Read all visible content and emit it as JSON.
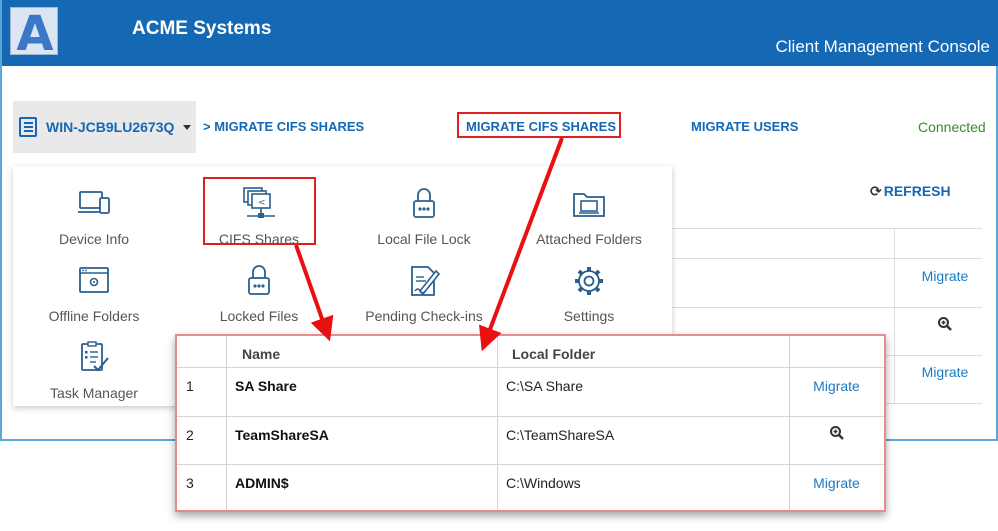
{
  "app": {
    "logo_letter": "A",
    "title": "ACME Systems",
    "console_title": "Client Management Console"
  },
  "device": {
    "name": "WIN-JCB9LU2673Q"
  },
  "nav": {
    "breadcrumb": "> MIGRATE CIFS SHARES",
    "migrate_cifs": "MIGRATE CIFS SHARES",
    "migrate_users": "MIGRATE USERS",
    "status": "Connected"
  },
  "toolbar": {
    "refresh": "REFRESH",
    "refresh_icon": "refresh-icon"
  },
  "menu": {
    "tiles": [
      {
        "label": "Device Info",
        "icon": "devices-icon"
      },
      {
        "label": "CIFS Shares",
        "icon": "network-share-icon"
      },
      {
        "label": "Local File Lock",
        "icon": "lock-icon"
      },
      {
        "label": "Attached Folders",
        "icon": "attached-folder-icon"
      },
      {
        "label": "Offline Folders",
        "icon": "offline-folder-icon"
      },
      {
        "label": "Locked Files",
        "icon": "locked-files-icon"
      },
      {
        "label": "Pending Check-ins",
        "icon": "pending-checkin-icon"
      },
      {
        "label": "Settings",
        "icon": "gear-icon"
      },
      {
        "label": "Task Manager",
        "icon": "task-manager-icon"
      }
    ]
  },
  "background_table": {
    "row_actions": [
      "Migrate",
      "",
      "Migrate"
    ]
  },
  "shares_table": {
    "columns": [
      "",
      "Name",
      "Local Folder",
      ""
    ],
    "rows": [
      {
        "index": "1",
        "name": "SA Share",
        "folder": "C:\\SA Share",
        "action": "Migrate"
      },
      {
        "index": "2",
        "name": "TeamShareSA",
        "folder": "C:\\TeamShareSA",
        "action": ""
      },
      {
        "index": "3",
        "name": "ADMIN$",
        "folder": "C:\\Windows",
        "action": "Migrate"
      }
    ]
  },
  "colors": {
    "header_blue": "#1568b4",
    "highlight_red": "#e02020",
    "link_blue": "#1a7ac4",
    "connected_green": "#3b8a2e"
  }
}
